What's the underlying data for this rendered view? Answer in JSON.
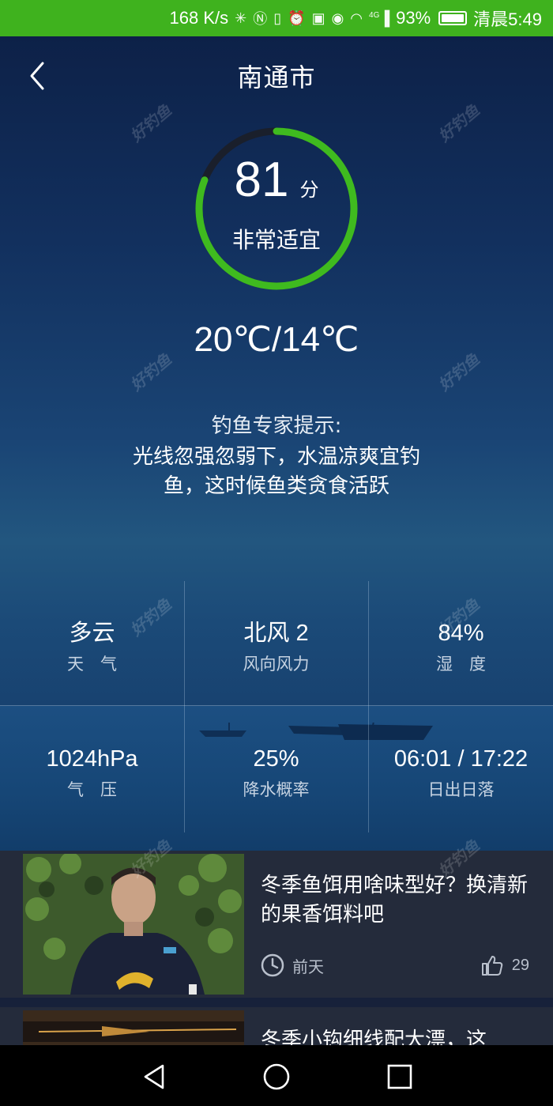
{
  "status_bar": {
    "net_speed": "168 K/s",
    "network": "4G",
    "battery": "93%",
    "time": "清晨5:49"
  },
  "header": {
    "title": "南通市"
  },
  "score": {
    "value": "81",
    "unit": "分",
    "level_text": "非常适宜",
    "fraction": 0.81,
    "accent_color": "#3fba1f"
  },
  "temperature": "20℃/14℃",
  "tip": {
    "title": "钓鱼专家提示:",
    "text": "光线忽强忽弱下，水温凉爽宜钓鱼，这时候鱼类贪食活跃"
  },
  "weather": [
    {
      "value": "多云",
      "label": "天　气"
    },
    {
      "value": "北风 2",
      "label": "风向风力"
    },
    {
      "value": "84%",
      "label": "湿　度"
    },
    {
      "value": "1024hPa",
      "label": "气　压"
    },
    {
      "value": "25%",
      "label": "降水概率"
    },
    {
      "value": "06:01 / 17:22",
      "label": "日出日落"
    }
  ],
  "articles": [
    {
      "title": "冬季鱼饵用啥味型好？换清新的果香饵料吧",
      "time": "前天",
      "likes": "29"
    },
    {
      "title": "冬季小钩细线配大漂，这"
    }
  ],
  "watermark": "好钓鱼"
}
